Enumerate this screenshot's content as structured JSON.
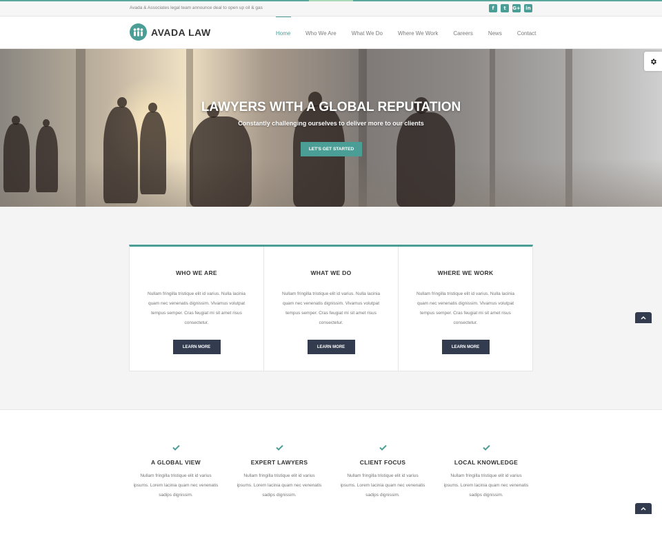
{
  "topbar": {
    "announcement": "Avada & Associates legal team announce deal to open up oil & gas",
    "socials": [
      {
        "icon": "facebook-icon",
        "glyph": "f"
      },
      {
        "icon": "twitter-icon",
        "glyph": "t"
      },
      {
        "icon": "google-plus-icon",
        "glyph": "G+"
      },
      {
        "icon": "linkedin-icon",
        "glyph": "in"
      }
    ]
  },
  "header": {
    "logo_text": "AVADA LAW",
    "nav": [
      "Home",
      "Who We Are",
      "What We Do",
      "Where We Work",
      "Careers",
      "News",
      "Contact"
    ],
    "active_nav": "Home"
  },
  "hero": {
    "title": "LAWYERS WITH A GLOBAL REPUTATION",
    "subtitle": "Constantly challenging ourselves to deliver more to our clients",
    "button": "LET'S GET STARTED"
  },
  "cards": [
    {
      "title": "WHO WE ARE",
      "text": "Nullam fringilla tristique elit id varius. Nulla lacinia quam nec venenatis dignissim. Vivamus volutpat tempus semper. Cras feugiat mi sit amet risus consectetur.",
      "button": "LEARN MORE"
    },
    {
      "title": "WHAT WE DO",
      "text": "Nullam fringilla tristique elit id varius. Nulla lacinia quam nec venenatis dignissim. Vivamus volutpat tempus semper. Cras feugiat mi sit amet risus consectetur.",
      "button": "LEARN MORE"
    },
    {
      "title": "WHERE WE WORK",
      "text": "Nullam fringilla tristique elit id varius. Nulla lacinia quam nec venenatis dignissim. Vivamus volutpat tempus semper. Cras feugiat mi sit amet risus consectetur.",
      "button": "LEARN MORE"
    }
  ],
  "features": [
    {
      "title": "A GLOBAL VIEW",
      "text": "Nullam fringilla tristique elit id varius ipsums. Lorem lacinia quam nec venenatis sadips dignissim."
    },
    {
      "title": "EXPERT LAWYERS",
      "text": "Nullam fringilla tristique elit id varius ipsums. Lorem lacinia quam nec venenatis sadips dignissim."
    },
    {
      "title": "CLIENT FOCUS",
      "text": "Nullam fringilla tristique elit id varius ipsums. Lorem lacinia quam nec venenatis sadips dignissim."
    },
    {
      "title": "LOCAL KNOWLEDGE",
      "text": "Nullam fringilla tristique elit id varius ipsums. Lorem lacinia quam nec venenatis sadips dignissim."
    }
  ],
  "colors": {
    "accent": "#4a9e95",
    "dark_button": "#333c4e",
    "section_gray": "#f4f4f4"
  }
}
